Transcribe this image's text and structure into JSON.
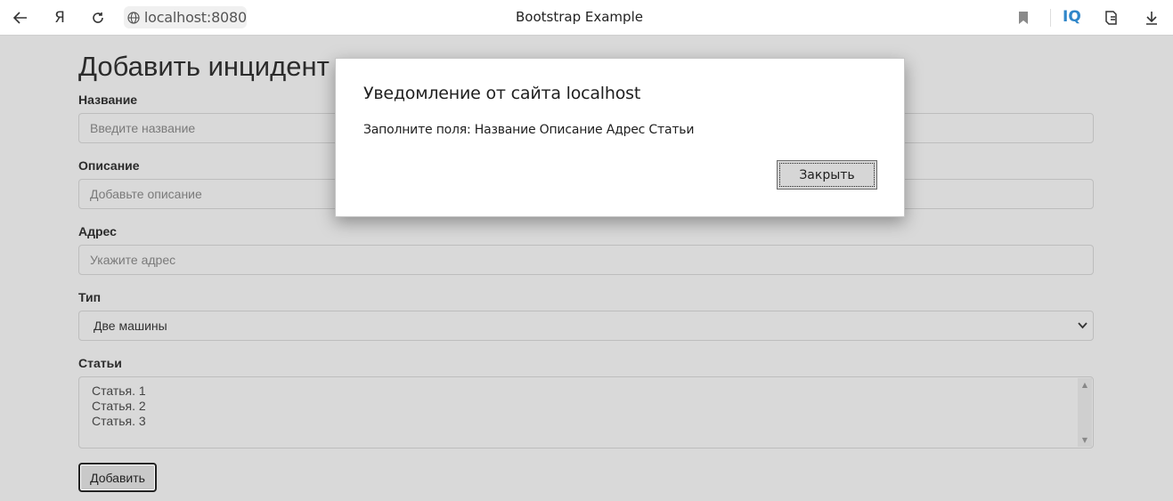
{
  "browser": {
    "url": "localhost:8080",
    "tab_title": "Bootstrap Example",
    "brand_icon": "Я",
    "iq_label": "IQ"
  },
  "page": {
    "title": "Добавить инцидент",
    "fields": {
      "name": {
        "label": "Название",
        "placeholder": "Введите название"
      },
      "description": {
        "label": "Описание",
        "placeholder": "Добавьте описание"
      },
      "address": {
        "label": "Адрес",
        "placeholder": "Укажите адрес"
      },
      "type": {
        "label": "Тип",
        "selected": "Две машины"
      },
      "articles": {
        "label": "Статьи",
        "options": [
          "Статья. 1",
          "Статья. 2",
          "Статья. 3"
        ]
      }
    },
    "submit_label": "Добавить"
  },
  "dialog": {
    "title": "Уведомление от сайта localhost",
    "message": "Заполните поля: Название Описание Адрес Статьи",
    "close_label": "Закрыть"
  }
}
